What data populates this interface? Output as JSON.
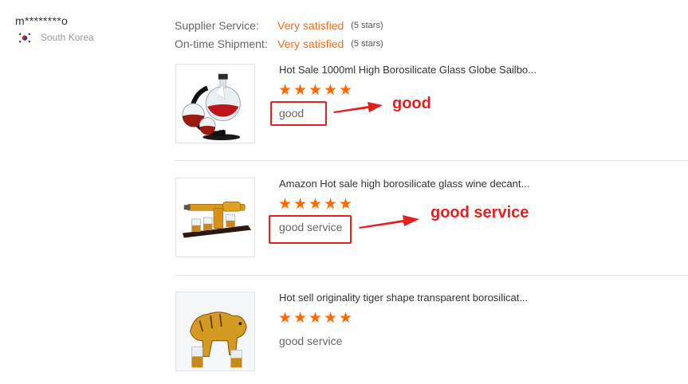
{
  "reviewer": {
    "name": "m********o",
    "country": "South Korea",
    "flag_icon": "south-korea-flag-icon"
  },
  "ratings": [
    {
      "label": "Supplier Service:",
      "value": "Very satisfied",
      "stars": "(5 stars)"
    },
    {
      "label": "On-time Shipment:",
      "value": "Very satisfied",
      "stars": "(5 stars)"
    }
  ],
  "items": [
    {
      "title": "Hot Sale 1000ml High Borosilicate Glass Globe Sailbo...",
      "rating": 5,
      "comment": "good",
      "image_icon": "globe-decanter-image"
    },
    {
      "title": "Amazon Hot sale high borosilicate glass wine decant...",
      "rating": 5,
      "comment": "good service",
      "image_icon": "gun-decanter-image"
    },
    {
      "title": "Hot sell originality tiger shape transparent borosilicat...",
      "rating": 5,
      "comment": "good service",
      "image_icon": "tiger-decanter-image"
    }
  ],
  "annotations": [
    {
      "text": "good",
      "color": "#e32020"
    },
    {
      "text": "good service",
      "color": "#e32020"
    }
  ],
  "colors": {
    "accent_orange": "#ee6e1c",
    "star_orange": "#ff6a00",
    "annotation_red": "#e32020"
  }
}
